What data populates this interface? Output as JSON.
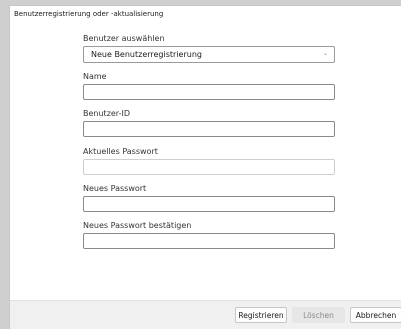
{
  "window": {
    "title": "Benutzerregistrierung oder -aktualisierung"
  },
  "form": {
    "user_select": {
      "label": "Benutzer auswählen",
      "value": "Neue Benutzerregistrierung",
      "icon": "chevron-down-icon"
    },
    "name": {
      "label": "Name",
      "value": ""
    },
    "user_id": {
      "label": "Benutzer-ID",
      "value": ""
    },
    "current_password": {
      "label": "Aktuelles Passwort",
      "value": ""
    },
    "new_password": {
      "label": "Neues Passwort",
      "value": ""
    },
    "confirm_password": {
      "label": "Neues Passwort bestätigen",
      "value": ""
    }
  },
  "buttons": {
    "register": "Registrieren",
    "delete": "Löschen",
    "cancel": "Abbrechen"
  },
  "colors": {
    "window_background": "#ffffff",
    "footer_background": "#f0f0f0",
    "disabled_button": "#e6e6e6"
  }
}
